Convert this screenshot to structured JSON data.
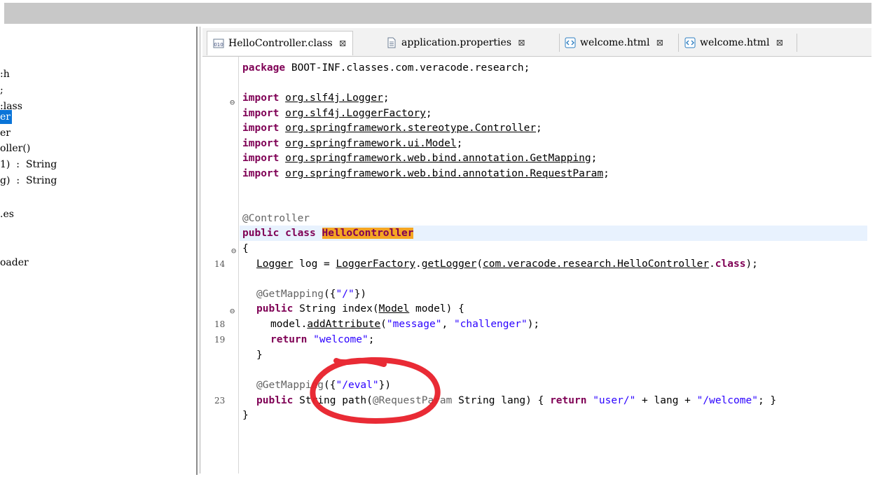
{
  "outline": {
    "items": [
      {
        "text": ":h"
      },
      {
        "text": ";"
      },
      {
        "text": ":lass"
      },
      {
        "text": "er",
        "selected": true
      },
      {
        "text": "er"
      },
      {
        "text": "oller()"
      },
      {
        "text": "1)  :  String"
      },
      {
        "text": "g)  :  String"
      },
      {
        "text": ".es"
      },
      {
        "text": "oader"
      }
    ]
  },
  "tabs": [
    {
      "label": "HelloController.class",
      "icon": "class-file-icon",
      "active": true,
      "close": "⊠"
    },
    {
      "label": "application.properties",
      "icon": "text-file-icon",
      "active": false,
      "close": "⊠"
    },
    {
      "label": "welcome.html",
      "icon": "html-file-icon",
      "active": false,
      "close": "⊠"
    },
    {
      "label": "welcome.html",
      "icon": "html-file-icon",
      "active": false,
      "close": "⊠"
    }
  ],
  "code": {
    "package_kw": "package",
    "package_name": " BOOT-INF.classes.com.veracode.research;",
    "imports": [
      "org.slf4j.Logger",
      "org.slf4j.LoggerFactory",
      "org.springframework.stereotype.Controller",
      "org.springframework.ui.Model",
      "org.springframework.web.bind.annotation.GetMapping",
      "org.springframework.web.bind.annotation.RequestParam"
    ],
    "import_kw": "import",
    "controller_ann": "@Controller",
    "class_decl_kw": "public class",
    "class_name": "HelloController",
    "open_brace": "{",
    "logger_type": "Logger",
    "logger_mid": " log = ",
    "logger_factory": "LoggerFactory",
    "logger_dot": ".",
    "logger_method": "getLogger",
    "logger_paren": "(",
    "logger_arg": "com.veracode.research.HelloController",
    "logger_class_kw": "class",
    "logger_end": ");",
    "getmapping1_ann": "@GetMapping",
    "getmapping1_open": "({",
    "getmapping1_str": "\"/\"",
    "getmapping1_close": "})",
    "index_kw": "public",
    "index_sig": " String index(",
    "index_model": "Model",
    "index_sig_end": " model) {",
    "addattr_prefix": "model.",
    "addattr_method": "addAttribute",
    "addattr_open": "(",
    "addattr_str1": "\"message\"",
    "addattr_comma": ", ",
    "addattr_str2": "\"challenger\"",
    "addattr_end": ");",
    "return_kw": "return",
    "return_str": " \"welcome\"",
    "return_end": ";",
    "close_brace": "}",
    "getmapping2_ann": "@GetMapping",
    "getmapping2_open": "({",
    "getmapping2_str": "\"/eval\"",
    "getmapping2_close": "})",
    "path_kw": "public",
    "path_sig": " String path(",
    "path_reqparam": "@RequestParam",
    "path_sig2": " String lang) { ",
    "path_return_kw": "return",
    "path_str1": " \"user/\"",
    "path_plus1": " + lang + ",
    "path_str2": "\"/welcome\"",
    "path_end": "; }",
    "class_close": "}"
  },
  "line_numbers": {
    "logger": "14",
    "addattr": "18",
    "return": "19",
    "path": "23"
  },
  "colors": {
    "keyword": "#7f0055",
    "string": "#2a00ff",
    "annotation": "#646464",
    "highlight": "#f5a623",
    "circle": "#e8202a"
  }
}
